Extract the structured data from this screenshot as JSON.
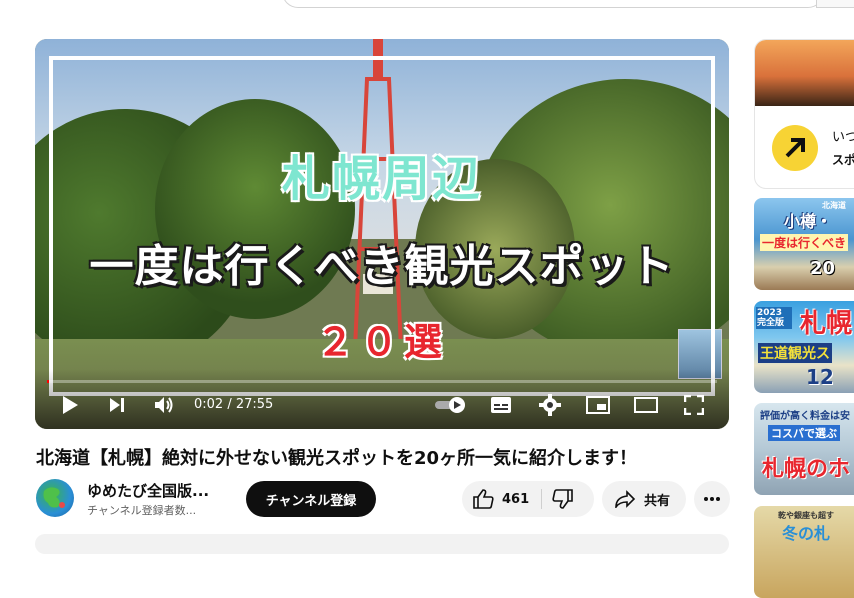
{
  "player": {
    "overlay_title_line1": "札幌周辺",
    "overlay_title_line2": "一度は行くべき観光スポット",
    "overlay_title_line3": "２０選",
    "time_current": "0:02",
    "time_total": "27:55",
    "progress_fraction": 0.0012
  },
  "video": {
    "title": "北海道【札幌】絶対に外せない観光スポットを20ヶ所一気に紹介します！",
    "channel_name": "ゆめたび全国版...",
    "subscribers": "チャンネル登録者数...",
    "subscribe_label": "チャンネル登録",
    "likes": "461",
    "share_label": "共有"
  },
  "sidebar": {
    "ad": {
      "text1": "いつ",
      "text2": "スポ"
    },
    "thumbs": [
      {
        "line1": "北海道",
        "line2": "小樽・",
        "line3": "一度は行くべき",
        "line4": "20"
      },
      {
        "line1": "2023 完全版",
        "line2": "札幌",
        "line3": "王道観光ス",
        "line4": "12"
      },
      {
        "line1": "評価が高く料金は安",
        "line2": "コスパで選ぶ",
        "line3": "札幌のホ"
      },
      {
        "line1": "乾や銀座も超す",
        "line2": "冬の札"
      }
    ]
  },
  "colors": {
    "accent": "#ff0000",
    "subscribe_bg": "#0f0f0f",
    "pill_bg": "#f2f2f2"
  },
  "icons": [
    "play-icon",
    "next-icon",
    "volume-icon",
    "autoplay-toggle",
    "subtitles-icon",
    "settings-icon",
    "miniplayer-icon",
    "theater-icon",
    "fullscreen-icon",
    "thumbs-up-icon",
    "thumbs-down-icon",
    "share-icon",
    "more-icon"
  ]
}
